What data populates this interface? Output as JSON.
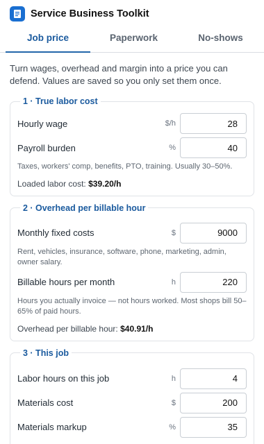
{
  "app": {
    "title": "Service Business Toolkit",
    "icon": "document-icon",
    "accent": "#1a6fd1"
  },
  "tabs": [
    {
      "label": "Job price",
      "active": true
    },
    {
      "label": "Paperwork",
      "active": false
    },
    {
      "label": "No-shows",
      "active": false
    }
  ],
  "intro": "Turn wages, overhead and margin into a price you can defend. Values are saved so you only set them once.",
  "sections": {
    "labor": {
      "title": "1 · True labor cost",
      "hourly_wage": {
        "label": "Hourly wage",
        "unit": "$/h",
        "value": "28"
      },
      "payroll_burden": {
        "label": "Payroll burden",
        "unit": "%",
        "value": "40"
      },
      "help": "Taxes, workers' comp, benefits, PTO, training. Usually 30–50%.",
      "result_label": "Loaded labor cost:",
      "result_value": "$39.20/h"
    },
    "overhead": {
      "title": "2 · Overhead per billable hour",
      "monthly_fixed": {
        "label": "Monthly fixed costs",
        "unit": "$",
        "value": "9000"
      },
      "monthly_help": "Rent, vehicles, insurance, software, phone, marketing, admin, owner salary.",
      "billable_hours": {
        "label": "Billable hours per month",
        "unit": "h",
        "value": "220"
      },
      "billable_help": "Hours you actually invoice — not hours worked. Most shops bill 50–65% of paid hours.",
      "result_label": "Overhead per billable hour:",
      "result_value": "$40.91/h"
    },
    "job": {
      "title": "3 · This job",
      "labor_hours": {
        "label": "Labor hours on this job",
        "unit": "h",
        "value": "4"
      },
      "materials_cost": {
        "label": "Materials cost",
        "unit": "$",
        "value": "200"
      },
      "materials_markup": {
        "label": "Materials markup",
        "unit": "%",
        "value": "35"
      }
    }
  }
}
